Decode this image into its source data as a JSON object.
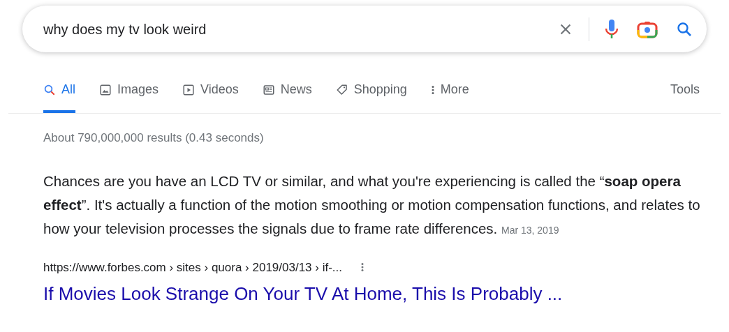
{
  "search": {
    "value": "why does my tv look weird"
  },
  "tabs": [
    {
      "kind": "all",
      "label": "All",
      "selected": true
    },
    {
      "kind": "images",
      "label": "Images",
      "selected": false
    },
    {
      "kind": "videos",
      "label": "Videos",
      "selected": false
    },
    {
      "kind": "news",
      "label": "News",
      "selected": false
    },
    {
      "kind": "shopping",
      "label": "Shopping",
      "selected": false
    },
    {
      "kind": "more",
      "label": "More",
      "selected": false
    }
  ],
  "tools": "Tools",
  "result_stats": "About 790,000,000 results (0.43 seconds)",
  "snippet": {
    "text": "Chances are you have an LCD TV or similar, and what you're experiencing is called the “**soap opera effect**”. It's actually a function of the motion smoothing or motion compensation functions, and relates to how your television processes the signals due to frame rate differences.",
    "date": "Mar 13, 2019"
  },
  "result": {
    "url": "https://www.forbes.com › sites › quora › 2019/03/13 › if-...",
    "title": "If Movies Look Strange On Your TV At Home, This Is Probably ..."
  }
}
